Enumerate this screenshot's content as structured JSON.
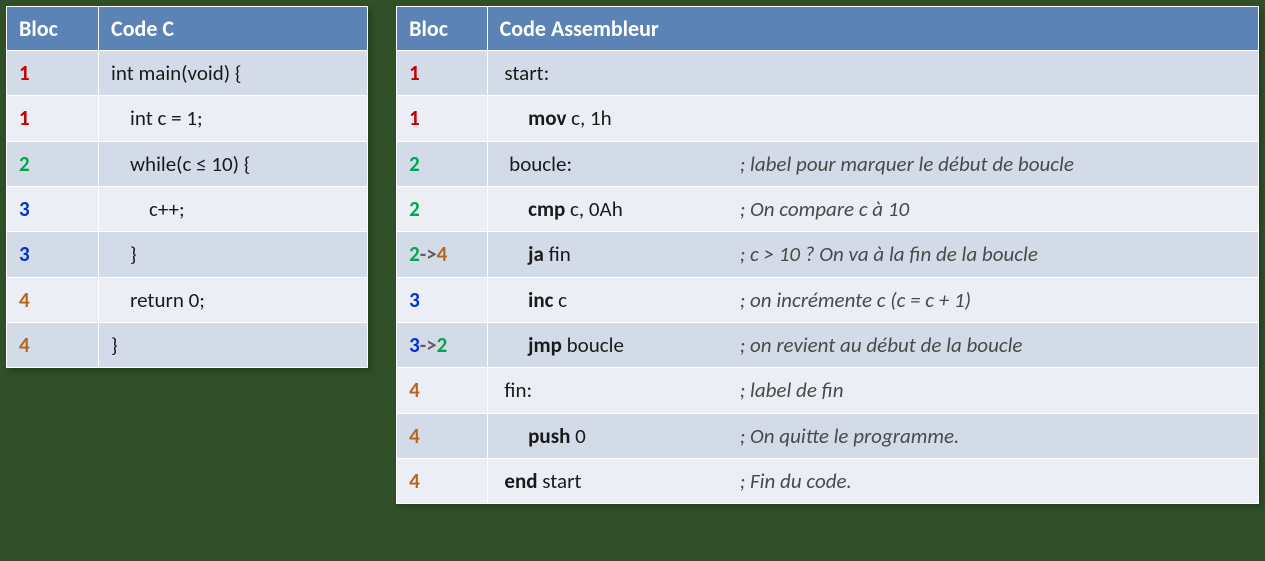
{
  "tables": {
    "c": {
      "headers": {
        "bloc": "Bloc",
        "code": "Code C"
      },
      "rows": [
        {
          "bloc": [
            {
              "t": "1",
              "c": "red"
            }
          ],
          "indent": 0,
          "code": [
            {
              "t": "int main(void) {"
            }
          ]
        },
        {
          "bloc": [
            {
              "t": "1",
              "c": "red"
            }
          ],
          "indent": 2,
          "code": [
            {
              "t": "int c = 1;"
            }
          ]
        },
        {
          "bloc": [
            {
              "t": "2",
              "c": "green"
            }
          ],
          "indent": 2,
          "code": [
            {
              "t": "while(c  ≤ 10) {"
            }
          ]
        },
        {
          "bloc": [
            {
              "t": "3",
              "c": "blue"
            }
          ],
          "indent": 4,
          "code": [
            {
              "t": "c++;"
            }
          ]
        },
        {
          "bloc": [
            {
              "t": "3",
              "c": "blue"
            }
          ],
          "indent": 2,
          "code": [
            {
              "t": "}"
            }
          ]
        },
        {
          "bloc": [
            {
              "t": "4",
              "c": "brown"
            }
          ],
          "indent": 2,
          "code": [
            {
              "t": "return 0;"
            }
          ]
        },
        {
          "bloc": [
            {
              "t": "4",
              "c": "brown"
            }
          ],
          "indent": 0,
          "code": [
            {
              "t": "}"
            }
          ]
        }
      ]
    },
    "asm": {
      "headers": {
        "bloc": "Bloc",
        "code": "Code Assembleur"
      },
      "rows": [
        {
          "bloc": [
            {
              "t": "1",
              "c": "red"
            }
          ],
          "indent": 1,
          "instr": [
            {
              "t": "start:"
            }
          ],
          "comment": ""
        },
        {
          "bloc": [
            {
              "t": "1",
              "c": "red"
            }
          ],
          "indent": 6,
          "instr": [
            {
              "t": "mov",
              "kw": true
            },
            {
              "t": " c, 1h"
            }
          ],
          "comment": ""
        },
        {
          "bloc": [
            {
              "t": "2",
              "c": "green"
            }
          ],
          "indent": 2,
          "instr": [
            {
              "t": "boucle:"
            }
          ],
          "comment": "; label pour marquer le début de boucle"
        },
        {
          "bloc": [
            {
              "t": "2",
              "c": "green"
            }
          ],
          "indent": 6,
          "instr": [
            {
              "t": "cmp",
              "kw": true
            },
            {
              "t": " c, 0Ah"
            }
          ],
          "comment": "; On compare c à 10"
        },
        {
          "bloc": [
            {
              "t": "2",
              "c": "green"
            },
            {
              "t": "->",
              "c": "arrow"
            },
            {
              "t": "4",
              "c": "brown"
            }
          ],
          "indent": 6,
          "instr": [
            {
              "t": "ja",
              "kw": true
            },
            {
              "t": " fin"
            }
          ],
          "comment": "; c > 10 ? On va à la fin de la boucle"
        },
        {
          "bloc": [
            {
              "t": "3",
              "c": "blue"
            }
          ],
          "indent": 6,
          "instr": [
            {
              "t": "inc",
              "kw": true
            },
            {
              "t": "    c"
            }
          ],
          "comment": "; on incrémente c (c = c + 1)"
        },
        {
          "bloc": [
            {
              "t": "3",
              "c": "blue"
            },
            {
              "t": "->",
              "c": "arrow"
            },
            {
              "t": "2",
              "c": "green"
            }
          ],
          "indent": 6,
          "instr": [
            {
              "t": "jmp",
              "kw": true
            },
            {
              "t": " boucle"
            }
          ],
          "comment": "; on revient au début de la boucle"
        },
        {
          "bloc": [
            {
              "t": "4",
              "c": "brown"
            }
          ],
          "indent": 1,
          "instr": [
            {
              "t": "fin:"
            }
          ],
          "comment": "; label de fin"
        },
        {
          "bloc": [
            {
              "t": "4",
              "c": "brown"
            }
          ],
          "indent": 6,
          "instr": [
            {
              "t": "push",
              "kw": true
            },
            {
              "t": " 0"
            }
          ],
          "comment": "; On quitte le programme."
        },
        {
          "bloc": [
            {
              "t": "4",
              "c": "brown"
            }
          ],
          "indent": 1,
          "instr": [
            {
              "t": "end",
              "kw": true
            },
            {
              "t": " start"
            }
          ],
          "comment": "; Fin du code."
        }
      ]
    }
  }
}
